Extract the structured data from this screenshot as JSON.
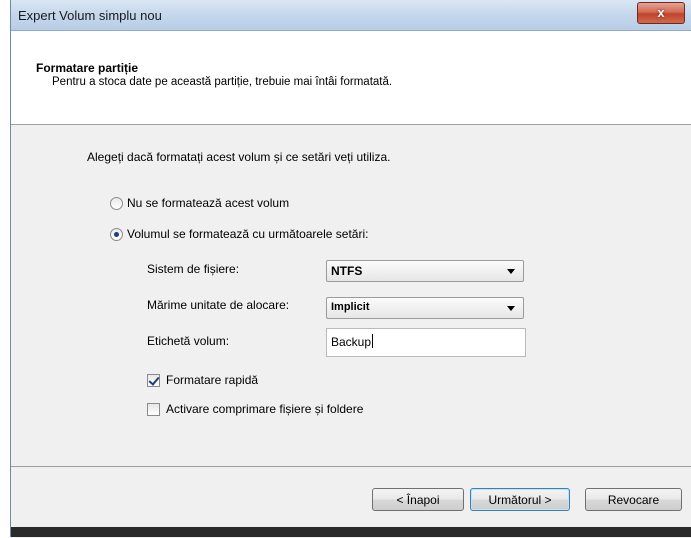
{
  "window": {
    "title": "Expert Volum simplu nou",
    "close_label": "x"
  },
  "header": {
    "title": "Formatare partiție",
    "subtitle": "Pentru a stoca date pe această partiție, trebuie mai întâi formatată."
  },
  "content": {
    "instruction": "Alegeți dacă formatați acest volum și ce setări veți utiliza.",
    "radio_no_format": {
      "label": "Nu se formatează acest volum",
      "checked": false
    },
    "radio_format": {
      "label": "Volumul se formatează cu următoarele setări:",
      "checked": true
    },
    "file_system": {
      "label": "Sistem de fișiere:",
      "value": "NTFS"
    },
    "allocation_unit": {
      "label": "Mărime unitate de alocare:",
      "value": "Implicit"
    },
    "volume_label": {
      "label": "Etichetă volum:",
      "value": "Backup"
    },
    "quick_format": {
      "label": "Formatare rapidă",
      "checked": true
    },
    "compression": {
      "label": "Activare comprimare fișiere și foldere",
      "checked": false
    }
  },
  "footer": {
    "back_label": "< Înapoi",
    "next_label": "Următorul >",
    "cancel_label": "Revocare"
  }
}
